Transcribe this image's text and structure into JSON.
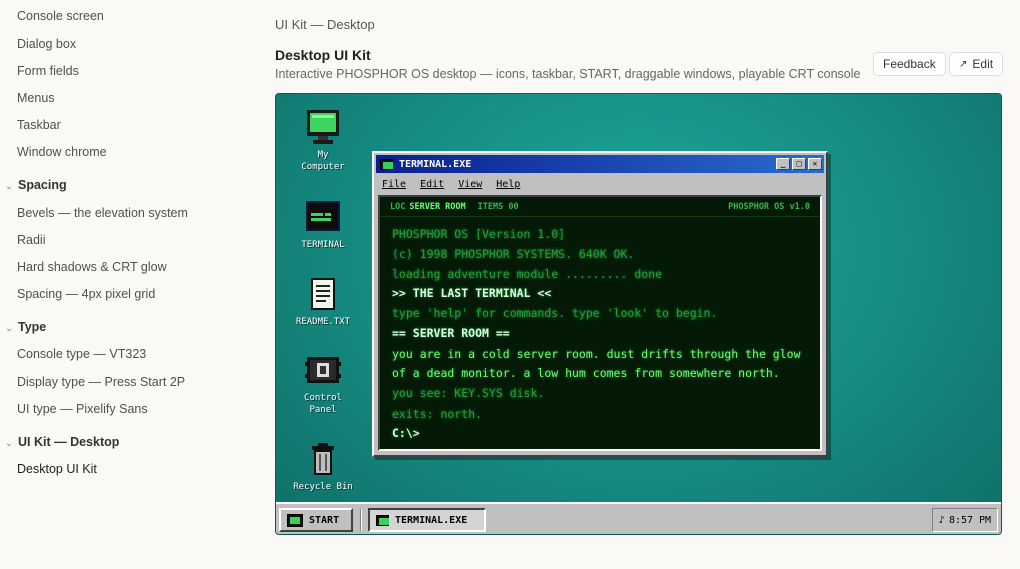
{
  "sidebar": {
    "items": [
      {
        "label": "Console screen"
      },
      {
        "label": "Dialog box"
      },
      {
        "label": "Form fields"
      },
      {
        "label": "Menus"
      },
      {
        "label": "Taskbar"
      },
      {
        "label": "Window chrome"
      }
    ],
    "groups": [
      {
        "label": "Spacing",
        "items": [
          "Bevels — the elevation system",
          "Radii",
          "Hard shadows & CRT glow",
          "Spacing — 4px pixel grid"
        ]
      },
      {
        "label": "Type",
        "items": [
          "Console type — VT323",
          "Display type — Press Start 2P",
          "UI type — Pixelify Sans"
        ]
      },
      {
        "label": "UI Kit — Desktop",
        "items": [
          "Desktop UI Kit"
        ]
      }
    ]
  },
  "header": {
    "breadcrumb": "UI Kit — Desktop",
    "title": "Desktop UI Kit",
    "subtitle": "Interactive PHOSPHOR OS desktop — icons, taskbar, START, draggable windows, playable CRT console",
    "feedback_label": "Feedback",
    "edit_label": "Edit",
    "edit_icon": "↗"
  },
  "desktop": {
    "accent": "#158a80",
    "icons": [
      {
        "label": "My Computer",
        "icon": "monitor-icon"
      },
      {
        "label": "TERMINAL",
        "icon": "terminal-icon"
      },
      {
        "label": "README.TXT",
        "icon": "document-icon"
      },
      {
        "label": "Control Panel",
        "icon": "control-panel-icon"
      },
      {
        "label": "Recycle Bin",
        "icon": "recycle-bin-icon"
      }
    ],
    "window": {
      "title": "TERMINAL.EXE",
      "menu": [
        "File",
        "Edit",
        "View",
        "Help"
      ],
      "console": {
        "loc_label": "LOC",
        "loc_value": "SERVER ROOM",
        "items": "ITEMS 00",
        "version": "PHOSPHOR OS v1.0",
        "lines": [
          "PHOSPHOR OS  [Version 1.0]",
          "(c) 1998 PHOSPHOR SYSTEMS. 640K OK.",
          "loading adventure module ......... done",
          ">> THE LAST TERMINAL <<",
          "type 'help' for commands. type 'look' to begin.",
          "== SERVER ROOM ==",
          "you are in a cold server room. dust drifts through the glow",
          "of a dead monitor. a low hum comes from somewhere north.",
          "you see: KEY.SYS disk.",
          "exits: north.",
          "C:\\>"
        ]
      }
    },
    "taskbar": {
      "start_label": "START",
      "task_label": "TERMINAL.EXE",
      "clock": "8:57 PM",
      "clock_icon": "♪"
    }
  }
}
